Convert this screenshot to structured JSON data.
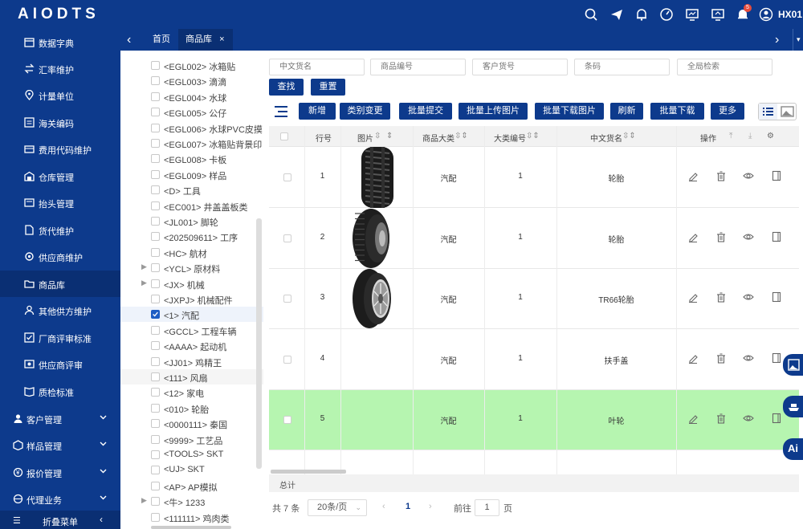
{
  "app": {
    "logo": "AIODTS",
    "user": "HX01",
    "notification_count": "5"
  },
  "top_icons": [
    "search-icon",
    "send-icon",
    "bell-icon",
    "dashboard-icon",
    "monitor-icon",
    "screen-share-icon",
    "notification-icon",
    "user-avatar-icon"
  ],
  "sidebar": {
    "items": [
      {
        "label": "数据字典",
        "icon": "calendar-icon"
      },
      {
        "label": "汇率维护",
        "icon": "exchange-icon"
      },
      {
        "label": "计量单位",
        "icon": "pin-icon"
      },
      {
        "label": "海关编码",
        "icon": "code-icon"
      },
      {
        "label": "费用代码维护",
        "icon": "wallet-icon"
      },
      {
        "label": "仓库管理",
        "icon": "warehouse-icon"
      },
      {
        "label": "抬头管理",
        "icon": "header-icon"
      },
      {
        "label": "货代维护",
        "icon": "document-icon"
      },
      {
        "label": "供应商维护",
        "icon": "gear-icon"
      },
      {
        "label": "商品库",
        "icon": "folder-icon"
      },
      {
        "label": "其他供方维护",
        "icon": "user-icon"
      },
      {
        "label": "厂商评审标准",
        "icon": "checklist-icon"
      },
      {
        "label": "供应商评审",
        "icon": "review-icon"
      },
      {
        "label": "质检标准",
        "icon": "book-icon"
      }
    ],
    "groups": [
      {
        "label": "客户管理",
        "icon": "customer-icon"
      },
      {
        "label": "样品管理",
        "icon": "box-icon"
      },
      {
        "label": "报价管理",
        "icon": "quote-icon"
      },
      {
        "label": "代理业务",
        "icon": "agent-icon"
      }
    ],
    "collapse_label": "折叠菜单"
  },
  "tabs": {
    "home": "首页",
    "product": "商品库"
  },
  "tree": [
    {
      "label": "<EGL002> 冰箱贴"
    },
    {
      "label": "<EGL003> 滴滴"
    },
    {
      "label": "<EGL004> 水球"
    },
    {
      "label": "<EGL005> 公仔"
    },
    {
      "label": "<EGL006> 水球PVC皮摸"
    },
    {
      "label": "<EGL007> 冰箱贴背景印"
    },
    {
      "label": "<EGL008> 卡板"
    },
    {
      "label": "<EGL009> 样品"
    },
    {
      "label": "<D> 工具"
    },
    {
      "label": "<EC001> 井盖盖板类"
    },
    {
      "label": "<JL001> 脚轮"
    },
    {
      "label": "<202509611> 工序"
    },
    {
      "label": "<HC> 航材"
    },
    {
      "label": "<YCL> 原材料",
      "arrow": true
    },
    {
      "label": "<JX> 机械",
      "arrow": true
    },
    {
      "label": "<JXPJ> 机械配件"
    },
    {
      "label": "<1> 汽配",
      "checked": true
    },
    {
      "label": "<GCCL> 工程车辆"
    },
    {
      "label": "<AAAA> 起动机"
    },
    {
      "label": "<JJ01> 鸡精王"
    },
    {
      "label": "<111> 风扇"
    },
    {
      "label": "<12> 家电"
    },
    {
      "label": "<010> 轮胎"
    },
    {
      "label": "<0000111> 秦国"
    },
    {
      "label": "<9999> 工艺品"
    },
    {
      "label": "<TOOLS> SKT"
    },
    {
      "label": "<UJ> SKT"
    },
    {
      "label": "<AP> AP模拟"
    },
    {
      "label": "<牛> 1233",
      "arrow": true
    },
    {
      "label": "<111111> 鸡肉类"
    }
  ],
  "search": {
    "placeholders": [
      "中文货名",
      "商品编号",
      "客户货号",
      "条码",
      "全局检索"
    ],
    "find": "查找",
    "reset": "重置"
  },
  "toolbar": [
    "新增",
    "类别变更",
    "批量提交",
    "批量上传图片",
    "批量下载图片",
    "刷新",
    "批量下载",
    "更多"
  ],
  "table": {
    "headers": {
      "row": "行号",
      "image": "图片",
      "category": "商品大类",
      "cat_no": "大类编号",
      "name": "中文货名",
      "ops": "操作"
    },
    "rows": [
      {
        "row": "1",
        "category": "汽配",
        "cat_no": "1",
        "name": "轮胎"
      },
      {
        "row": "2",
        "category": "汽配",
        "cat_no": "1",
        "name": "轮胎"
      },
      {
        "row": "3",
        "category": "汽配",
        "cat_no": "1",
        "name": "TR66轮胎"
      },
      {
        "row": "4",
        "category": "汽配",
        "cat_no": "1",
        "name": "扶手盖"
      },
      {
        "row": "5",
        "category": "汽配",
        "cat_no": "1",
        "name": "叶轮"
      }
    ],
    "footer": "总计"
  },
  "pager": {
    "total": "共 7 条",
    "size": "20条/页",
    "page": "1",
    "goto": "前往",
    "goto_value": "1",
    "unit": "页"
  },
  "colors": {
    "primary": "#0d3a8c",
    "highlight": "#b6f5b0"
  }
}
